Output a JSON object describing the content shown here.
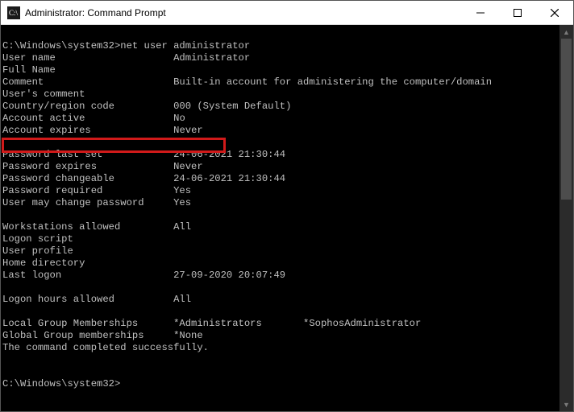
{
  "window": {
    "title": "Administrator: Command Prompt"
  },
  "prompt": {
    "path": "C:\\Windows\\system32>",
    "command": "net user administrator"
  },
  "fields": {
    "user_name": {
      "label": "User name",
      "value": "Administrator"
    },
    "full_name": {
      "label": "Full Name",
      "value": ""
    },
    "comment": {
      "label": "Comment",
      "value": "Built-in account for administering the computer/domain"
    },
    "users_comment": {
      "label": "User's comment",
      "value": ""
    },
    "country_code": {
      "label": "Country/region code",
      "value": "000 (System Default)"
    },
    "account_active": {
      "label": "Account active",
      "value": "No"
    },
    "account_expires": {
      "label": "Account expires",
      "value": "Never"
    },
    "password_last_set": {
      "label": "Password last set",
      "value": "24-06-2021 21:30:44"
    },
    "password_expires": {
      "label": "Password expires",
      "value": "Never"
    },
    "password_changeable": {
      "label": "Password changeable",
      "value": "24-06-2021 21:30:44"
    },
    "password_required": {
      "label": "Password required",
      "value": "Yes"
    },
    "user_may_change_password": {
      "label": "User may change password",
      "value": "Yes"
    },
    "workstations_allowed": {
      "label": "Workstations allowed",
      "value": "All"
    },
    "logon_script": {
      "label": "Logon script",
      "value": ""
    },
    "user_profile": {
      "label": "User profile",
      "value": ""
    },
    "home_directory": {
      "label": "Home directory",
      "value": ""
    },
    "last_logon": {
      "label": "Last logon",
      "value": "27-09-2020 20:07:49"
    },
    "logon_hours_allowed": {
      "label": "Logon hours allowed",
      "value": "All"
    },
    "local_group": {
      "label": "Local Group Memberships",
      "value": "*Administrators       *SophosAdministrator"
    },
    "global_group": {
      "label": "Global Group memberships",
      "value": "*None"
    }
  },
  "completion": "The command completed successfully.",
  "prompt2": "C:\\Windows\\system32>"
}
